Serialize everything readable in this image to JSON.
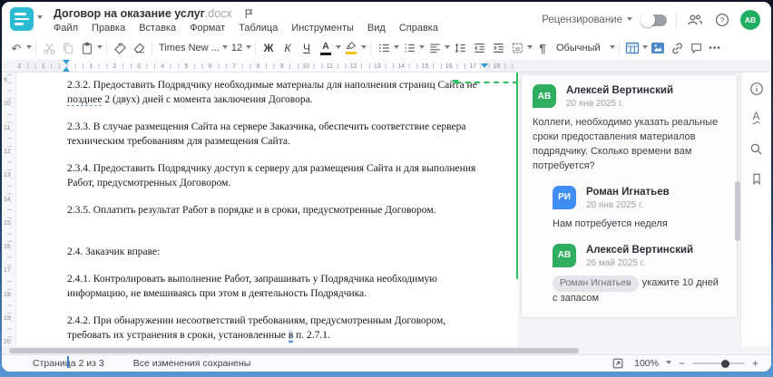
{
  "colors": {
    "brand_teal": "#2bbcd4",
    "comment_anchor_green": "#2fc061",
    "avatar_green": "#2fae60",
    "avatar_blue": "#3d8df5",
    "toolbar_accent_blue": "#4a86c8",
    "highlight_yellow": "#f3c51d"
  },
  "header": {
    "title": "Договор на оказание услуг",
    "title_ext": ".docx",
    "menu": [
      "Файл",
      "Правка",
      "Вставка",
      "Формат",
      "Таблица",
      "Инструменты",
      "Вид",
      "Справка"
    ],
    "review_label": "Рецензирование",
    "avatar_initials": "АВ"
  },
  "toolbar": {
    "font_name": "Times New ...",
    "font_size": "12",
    "bold_label": "Ж",
    "italic_label": "К",
    "underline_label": "Ч",
    "font_color_label": "А",
    "style_name": "Обычный",
    "paragraph_label": "¶",
    "more_label": "•••",
    "icons": [
      "undo",
      "cut",
      "copy",
      "paste",
      "format-painter",
      "eraser",
      "bullet-list",
      "numbered-list",
      "align",
      "line-spacing",
      "outdent",
      "indent",
      "frame",
      "table",
      "image",
      "link",
      "comment"
    ]
  },
  "ruler": {
    "left_numbers": [
      "2",
      "1"
    ],
    "numbers": [
      "1",
      "2",
      "3",
      "4",
      "5",
      "6",
      "7",
      "8",
      "9",
      "10",
      "11",
      "12",
      "13",
      "14",
      "15",
      "16",
      "17",
      "18"
    ],
    "v_numbers": [
      "9",
      "10",
      "11",
      "12",
      "13",
      "14",
      "15",
      "16",
      "17",
      "18",
      "19",
      "20"
    ]
  },
  "document": {
    "p232_before": "2.3.2. Предоставить Подрядчику необходимые материалы для наполнения страниц Сайта не ",
    "p232_underlined": "позднее",
    "p232_after": " 2 (двух) дней с момента заключения Договора.",
    "p233": "2.3.3. В случае размещения Сайта на сервере Заказчика, обеспечить соответствие сервера техническим требованиям для размещения Сайта.",
    "p234": "2.3.4. Предоставить Подрядчику доступ к серверу для размещения Сайта и для выполнения Работ, предусмотренных Договором.",
    "p235": "2.3.5. Оплатить результат Работ в порядке и в сроки, предусмотренные Договором.",
    "p24": "2.4. Заказчик вправе:",
    "p241": "2.4.1. Контролировать выполнение Работ, запрашивать у Подрядчика необходимую информацию, не вмешиваясь при этом в деятельность Подрядчика.",
    "p242_before": "2.4.2. При обнаружении несоответствий требованиям, предусмотренным Договором, требовать их устранения в сроки, установленные ",
    "p242_marked": "в",
    "p242_after": " п. 2.7.1."
  },
  "comments": {
    "main": {
      "initials": "АВ",
      "name": "Алексей Вертинский",
      "date": "20 янв 2025 г.",
      "text": "Коллеги, необходимо указать реальные сроки предоставления материалов подрядчику. Сколько времени вам потребуется?"
    },
    "reply1": {
      "initials": "РИ",
      "name": "Роман Игнатьев",
      "date": "20 янв 2025 г.",
      "text": "Нам потребуется неделя"
    },
    "reply2": {
      "initials": "АВ",
      "name": "Алексей Вертинский",
      "date": "26 май 2025 г.",
      "mention": "Роман Игнатьев",
      "text": "укажите 10 дней с запасом"
    }
  },
  "statusbar": {
    "page_info": "Страница 2 из 3",
    "saved_status": "Все изменения сохранены",
    "zoom_value": "100%"
  }
}
